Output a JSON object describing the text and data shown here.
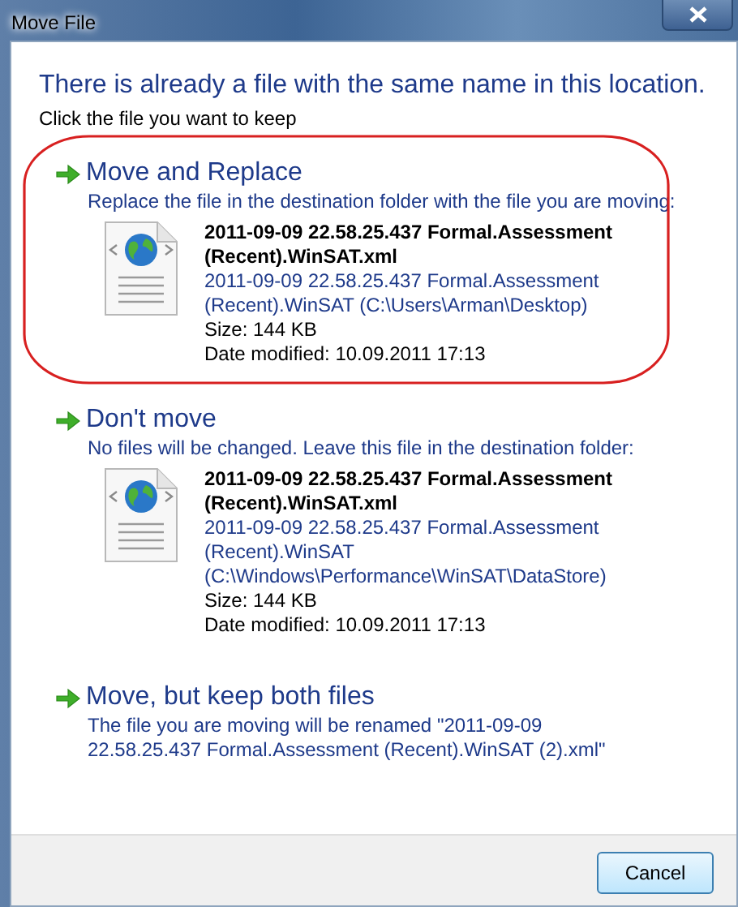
{
  "window": {
    "title": "Move File"
  },
  "heading": "There is already a file with the same name in this location.",
  "instruction": "Click the file you want to keep",
  "options": [
    {
      "kind": "file",
      "title": "Move and Replace",
      "description": "Replace the file in the destination folder with the file you are moving:",
      "circled": true,
      "file": {
        "name": "2011-09-09 22.58.25.437 Formal.Assessment (Recent).WinSAT.xml",
        "path": "2011-09-09 22.58.25.437 Formal.Assessment (Recent).WinSAT (C:\\Users\\Arman\\Desktop)",
        "size": "Size: 144 KB",
        "modified": "Date modified: 10.09.2011 17:13"
      }
    },
    {
      "kind": "file",
      "title": "Don't move",
      "description": "No files will be changed. Leave this file in the destination folder:",
      "circled": false,
      "file": {
        "name": "2011-09-09 22.58.25.437 Formal.Assessment (Recent).WinSAT.xml",
        "path": "2011-09-09 22.58.25.437 Formal.Assessment (Recent).WinSAT (C:\\Windows\\Performance\\WinSAT\\DataStore)",
        "size": "Size: 144 KB",
        "modified": "Date modified: 10.09.2011 17:13"
      }
    },
    {
      "kind": "text",
      "title": "Move, but keep both files",
      "description": "The file you are moving will be renamed \"2011-09-09 22.58.25.437 Formal.Assessment (Recent).WinSAT (2).xml\"",
      "circled": false
    }
  ],
  "buttons": [
    "Cancel"
  ]
}
